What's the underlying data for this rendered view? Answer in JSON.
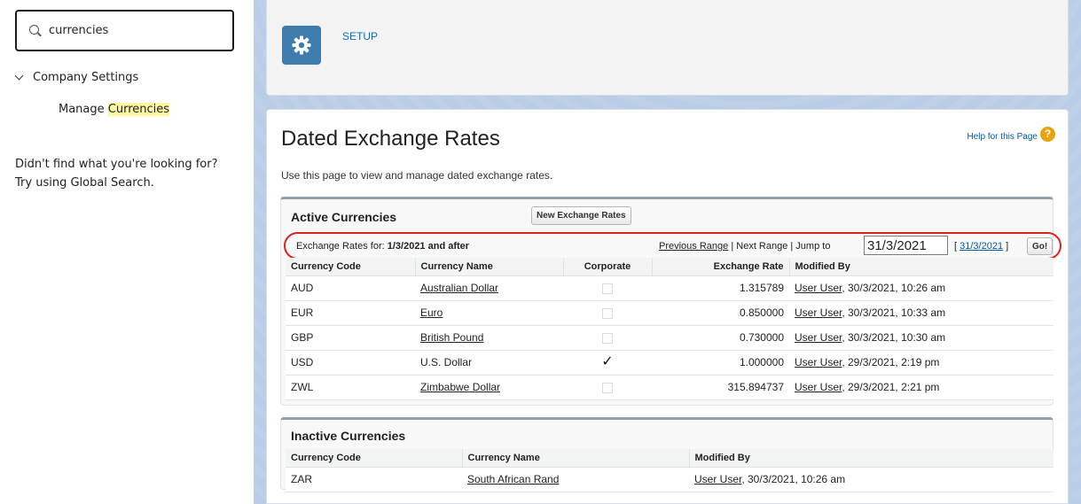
{
  "sidebar": {
    "search_value": "currencies",
    "tree_parent": "Company Settings",
    "tree_child_prefix": "Manage ",
    "tree_child_highlight": "Currencies",
    "not_found_line1": "Didn't find what you're looking for?",
    "not_found_line2": "Try using Global Search."
  },
  "header": {
    "setup_label": "SETUP",
    "icon": "gear-icon"
  },
  "page": {
    "title": "Dated Exchange Rates",
    "help_link": "Help for this Page",
    "help_icon": "?",
    "description": "Use this page to view and manage dated exchange rates."
  },
  "active": {
    "title": "Active Currencies",
    "new_button": "New Exchange Rates",
    "range_label": "Exchange Rates for: ",
    "range_value": "1/3/2021 and after",
    "previous_range": "Previous Range",
    "sep1": " | Next Range | Jump to",
    "jump_value": "31/3/2021",
    "bracket_open": "[ ",
    "date_link": "31/3/2021",
    "bracket_close": " ]",
    "go_button": "Go!",
    "columns": [
      "Currency Code",
      "Currency Name",
      "Corporate",
      "Exchange Rate",
      "Modified By"
    ],
    "rows": [
      {
        "code": "AUD",
        "name": "Australian Dollar",
        "name_link": true,
        "corporate": false,
        "rate": "1.315789",
        "user": "User User",
        "date": ", 30/3/2021, 10:26 am"
      },
      {
        "code": "EUR",
        "name": "Euro",
        "name_link": true,
        "corporate": false,
        "rate": "0.850000",
        "user": "User User",
        "date": ", 30/3/2021, 10:33 am"
      },
      {
        "code": "GBP",
        "name": "British Pound",
        "name_link": true,
        "corporate": false,
        "rate": "0.730000",
        "user": "User User",
        "date": ", 30/3/2021, 10:30 am"
      },
      {
        "code": "USD",
        "name": "U.S. Dollar",
        "name_link": false,
        "corporate": true,
        "rate": "1.000000",
        "user": "User User",
        "date": ", 29/3/2021, 2:19 pm"
      },
      {
        "code": "ZWL",
        "name": "Zimbabwe Dollar",
        "name_link": true,
        "corporate": false,
        "rate": "315.894737",
        "user": "User User",
        "date": ", 29/3/2021, 2:21 pm"
      }
    ]
  },
  "inactive": {
    "title": "Inactive Currencies",
    "columns": [
      "Currency Code",
      "Currency Name",
      "Modified By"
    ],
    "rows": [
      {
        "code": "ZAR",
        "name": "South African Rand",
        "user": "User User",
        "date": ", 30/3/2021, 10:26 am"
      }
    ]
  },
  "colors": {
    "accent": "#0070d2",
    "highlight_border": "#d9251d",
    "gear_tile": "#3e7cad"
  }
}
